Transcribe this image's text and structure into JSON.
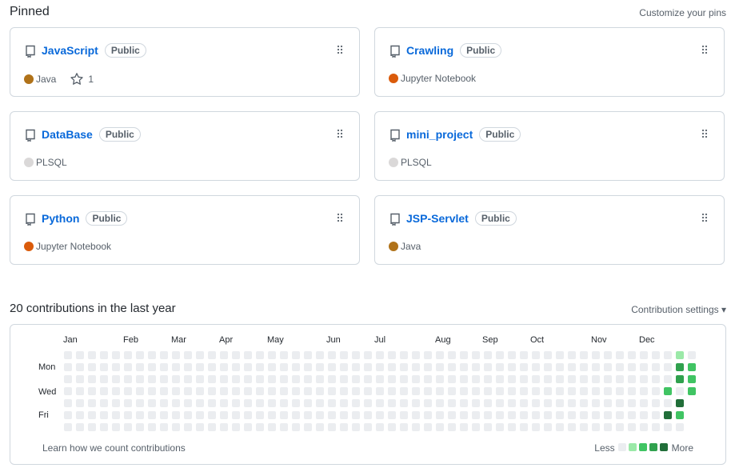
{
  "pinned": {
    "title": "Pinned",
    "customize_label": "Customize your pins",
    "repos": [
      {
        "name": "JavaScript",
        "badge": "Public",
        "language": "Java",
        "lang_color": "#b07219",
        "stars": "1"
      },
      {
        "name": "Crawling",
        "badge": "Public",
        "language": "Jupyter Notebook",
        "lang_color": "#DA5B0B"
      },
      {
        "name": "DataBase",
        "badge": "Public",
        "language": "PLSQL",
        "lang_color": "#dad8d8"
      },
      {
        "name": "mini_project",
        "badge": "Public",
        "language": "PLSQL",
        "lang_color": "#dad8d8"
      },
      {
        "name": "Python",
        "badge": "Public",
        "language": "Jupyter Notebook",
        "lang_color": "#DA5B0B"
      },
      {
        "name": "JSP-Servlet",
        "badge": "Public",
        "language": "Java",
        "lang_color": "#b07219"
      }
    ]
  },
  "contributions": {
    "title": "20 contributions in the last year",
    "settings_label": "Contribution settings",
    "months": [
      "Jan",
      "Feb",
      "Mar",
      "Apr",
      "May",
      "Jun",
      "Jul",
      "Aug",
      "Sep",
      "Oct",
      "Nov",
      "Dec"
    ],
    "days": [
      "Mon",
      "Wed",
      "Fri"
    ],
    "learn_label": "Learn how we count contributions",
    "legend_less": "Less",
    "legend_more": "More",
    "level_colors": [
      "#ebedf0",
      "#9be9a8",
      "#40c463",
      "#30a14e",
      "#216e39"
    ],
    "active_cells": [
      {
        "week": 50,
        "day": 3,
        "level": 2
      },
      {
        "week": 50,
        "day": 5,
        "level": 4
      },
      {
        "week": 51,
        "day": 0,
        "level": 1
      },
      {
        "week": 51,
        "day": 1,
        "level": 3
      },
      {
        "week": 51,
        "day": 2,
        "level": 3
      },
      {
        "week": 51,
        "day": 4,
        "level": 4
      },
      {
        "week": 51,
        "day": 5,
        "level": 2
      },
      {
        "week": 52,
        "day": 1,
        "level": 2
      },
      {
        "week": 52,
        "day": 2,
        "level": 2
      },
      {
        "week": 52,
        "day": 3,
        "level": 2
      }
    ]
  }
}
